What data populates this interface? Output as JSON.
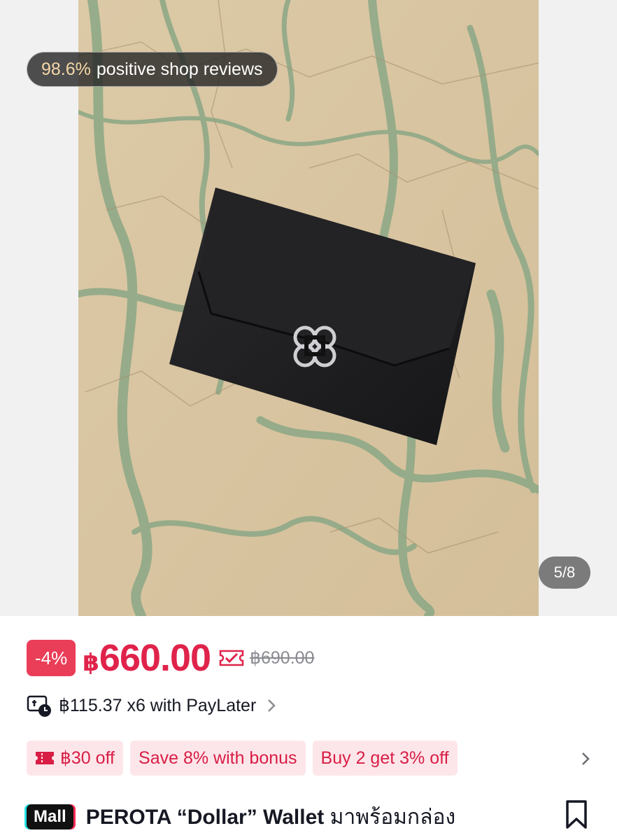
{
  "gallery": {
    "reviews_percent": "98.6%",
    "reviews_label": "positive shop reviews",
    "counter": "5/8",
    "product_image": "black leather wallet with silver knot clasp on green-veined marble surface"
  },
  "pricing": {
    "discount": "-4%",
    "currency": "฿",
    "price": "660.00",
    "original_price": "฿690.00",
    "coupon_icon": "coupon-check-icon",
    "accent_color": "#e0234a"
  },
  "paylater": {
    "icon": "paylater-clock-icon",
    "text": "฿115.37 x6 with PayLater"
  },
  "promos": [
    {
      "label": "฿30 off",
      "icon": "ticket-icon"
    },
    {
      "label": "Save 8% with bonus"
    },
    {
      "label": "Buy 2 get 3% off"
    }
  ],
  "product": {
    "badge": "Mall",
    "title_latin": "PEROTA “Dollar” Wallet",
    "title_thai": "มาพร้อมกล่อง"
  }
}
